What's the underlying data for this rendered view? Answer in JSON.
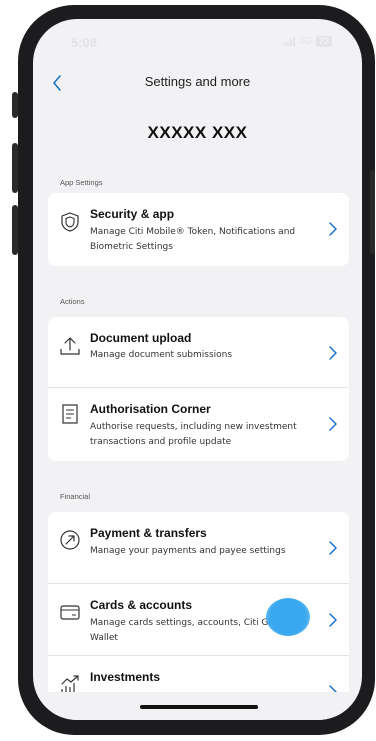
{
  "status": {
    "time": "5:08",
    "network": "4G",
    "battery": "72"
  },
  "nav": {
    "title": "Settings and more"
  },
  "user": {
    "name": "XXXXX XXX"
  },
  "sections": [
    {
      "label": "App Settings",
      "items": [
        {
          "title": "Security & app",
          "desc": "Manage Citi Mobile® Token, Notifications and Biometric Settings",
          "icon": "shield-icon"
        }
      ]
    },
    {
      "label": "Actions",
      "items": [
        {
          "title": "Document upload",
          "desc": "Manage document submissions",
          "icon": "upload-icon"
        },
        {
          "title": "Authorisation Corner",
          "desc": "Authorise requests, including new investment transactions and profile update",
          "icon": "document-icon"
        }
      ]
    },
    {
      "label": "Financial",
      "items": [
        {
          "title": "Payment & transfers",
          "desc": "Manage your payments and payee settings",
          "icon": "transfer-icon"
        },
        {
          "title": "Cards & accounts",
          "desc": "Manage cards settings, accounts, Citi Global Wallet",
          "icon": "card-icon"
        },
        {
          "title": "Investments",
          "desc": "",
          "icon": "investments-icon"
        }
      ]
    }
  ],
  "colors": {
    "background": "#f2f2f4",
    "card": "#ffffff",
    "accent": "#1a73c9",
    "touch": "#3aa8f0"
  }
}
